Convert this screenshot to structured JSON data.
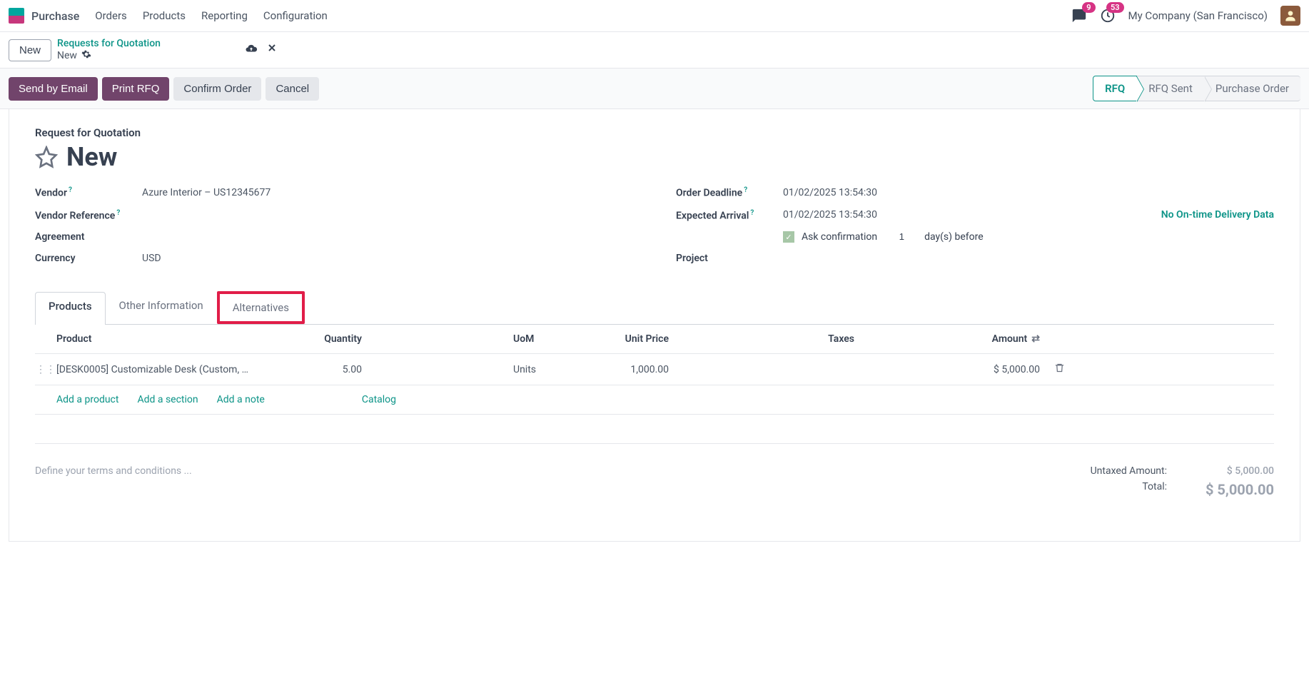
{
  "topbar": {
    "app": "Purchase",
    "menus": [
      "Orders",
      "Products",
      "Reporting",
      "Configuration"
    ],
    "msg_badge": "9",
    "act_badge": "53",
    "company": "My Company (San Francisco)"
  },
  "crumbs": {
    "new_btn": "New",
    "parent": "Requests for Quotation",
    "current": "New"
  },
  "actions": {
    "send": "Send by Email",
    "print": "Print RFQ",
    "confirm": "Confirm Order",
    "cancel": "Cancel"
  },
  "status": [
    "RFQ",
    "RFQ Sent",
    "Purchase Order"
  ],
  "form": {
    "type_label": "Request for Quotation",
    "name": "New",
    "vendor_label": "Vendor",
    "vendor": "Azure Interior – US12345677",
    "vendor_ref_label": "Vendor Reference",
    "agreement_label": "Agreement",
    "currency_label": "Currency",
    "currency": "USD",
    "deadline_label": "Order Deadline",
    "deadline": "01/02/2025 13:54:30",
    "arrival_label": "Expected Arrival",
    "arrival": "01/02/2025 13:54:30",
    "no_ontime": "No On-time Delivery Data",
    "ask_conf": "Ask confirmation",
    "days_val": "1",
    "days_after": "day(s) before",
    "project_label": "Project"
  },
  "tabs": [
    "Products",
    "Other Information",
    "Alternatives"
  ],
  "columns": {
    "product": "Product",
    "quantity": "Quantity",
    "uom": "UoM",
    "unit_price": "Unit Price",
    "taxes": "Taxes",
    "amount": "Amount"
  },
  "lines": [
    {
      "product": "[DESK0005] Customizable Desk (Custom, …",
      "qty": "5.00",
      "uom": "Units",
      "unit_price": "1,000.00",
      "taxes": "",
      "amount": "$ 5,000.00"
    }
  ],
  "addlinks": {
    "product": "Add a product",
    "section": "Add a section",
    "note": "Add a note",
    "catalog": "Catalog"
  },
  "terms_placeholder": "Define your terms and conditions ...",
  "totals": {
    "untaxed_label": "Untaxed Amount:",
    "untaxed": "$ 5,000.00",
    "total_label": "Total:",
    "total": "$ 5,000.00"
  }
}
